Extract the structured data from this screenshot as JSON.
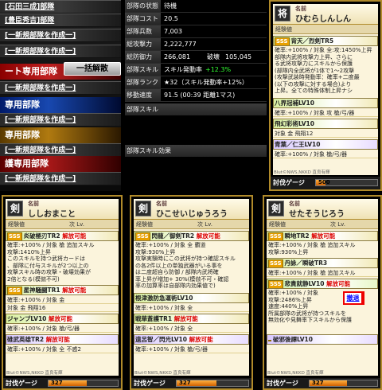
{
  "left_menu": {
    "rows": [
      {
        "type": "link",
        "label": "[石田三成]部隊"
      },
      {
        "type": "link",
        "label": "[豊臣秀吉]部隊"
      },
      {
        "type": "link",
        "label": "[一新規部隊を作成一]"
      },
      {
        "type": "link",
        "label": "[一新規部隊を作成一]"
      },
      {
        "type": "head-red",
        "label": "ート専用部隊"
      },
      {
        "type": "link",
        "label": "[一新規部隊を作成一]"
      },
      {
        "type": "head-blue",
        "label": "専用部隊"
      },
      {
        "type": "link",
        "label": "[一新規部隊を作成一]"
      },
      {
        "type": "head-gold",
        "label": "専用部隊"
      },
      {
        "type": "link",
        "label": "[一新規部隊を作成一]"
      },
      {
        "type": "head-maroon",
        "label": "護専用部隊"
      },
      {
        "type": "link",
        "label": "[一新規部隊を作成一]"
      }
    ],
    "bulk_button": "一括解散"
  },
  "stats": {
    "rows": [
      {
        "label": "部隊の状態",
        "value": "待機"
      },
      {
        "label": "部隊コスト",
        "value": "20.5"
      },
      {
        "label": "部隊兵数",
        "value": "7,003"
      },
      {
        "label": "総攻撃力",
        "value": "2,222,777"
      },
      {
        "label": "総防御力",
        "value": "266,081",
        "extra_label": "破壊",
        "extra_value": "105,045"
      },
      {
        "label": "部隊スキル",
        "value": "スキル発動率",
        "green": "+12.3%"
      },
      {
        "label": "部隊ランク",
        "value": "★32（スキル発動率+12%）"
      },
      {
        "label": "移動速度",
        "value": "91.5 (00:39 距離1マス)"
      }
    ],
    "section_skill": "部隊スキル",
    "section_effect": "部隊スキル効果"
  },
  "cards": [
    {
      "kanji": "将",
      "name_label": "名前",
      "name": "ひむらしんしん",
      "xp_label": "経験値",
      "skills": [
        {
          "rarity": "SSS",
          "title": "背天／烈剣TR5",
          "color": "plain"
        },
        {
          "rarity": "",
          "title": "八界冠補LV10",
          "color": "plain"
        },
        {
          "rarity": "",
          "title": "飛幻彩術LV10",
          "color": "plain"
        },
        {
          "rarity": "",
          "title": "青葉／仁王LV10",
          "color": "purple"
        }
      ],
      "body": [
        "確率:+100% / 対象 全:攻:1450%上昇",
        "部隊内武将攻撃力上昇、さらに",
        "る武将攻撃力にスキルから保護",
        "(部隊内全武将が1体で1〜2攻撃",
        "(攻撃武装時発動率：確率+二度最",
        "(以下の攻撃に対する場合)より",
        "上昇。全ての特殊体制上昇ナシ"
      ],
      "sub1": "確率:+100% / 対象 攻 槍/弓/器",
      "sub2": "対象 金 飛翔12",
      "sub3": "確率:+100% / 対象 槍/弓/器",
      "gauge_label": "討伐ゲージ",
      "gauge_value": "500",
      "gauge_pct": 0.15
    },
    {
      "kanji": "剣",
      "name_label": "名前",
      "name": "ししおまこと",
      "xp_label": "経験値",
      "lv_label": "次 Lv.",
      "skills": [
        {
          "rarity": "SSS",
          "title": "炎破極刃TR2",
          "note": "解放可能",
          "color": "plain"
        },
        {
          "rarity": "SSS",
          "title": "星神騒闘TR1",
          "note": "解放可能",
          "color": "plain"
        },
        {
          "rarity": "",
          "title": "ジャンプLV10",
          "note": "解放可能",
          "color": "plain"
        },
        {
          "rarity": "",
          "title": "碓武英雄TR2",
          "note": "解放可能",
          "color": "purple"
        }
      ],
      "body1": [
        "確率:+100% / 対象 槍 追加スキル",
        "攻撃:1410%上昇",
        "このスキルを持つ武将カードは",
        "、部隊に付与スキルが2つ以上の",
        "攻撃スキル時の攻撃・破壊効果が",
        "2倍となる(模倣不可)"
      ],
      "body2": [
        "確率:+100% / 対象 金",
        "対象 金 飛翔16"
      ],
      "body3": [
        "確率:+100% / 対象 槍/弓/器"
      ],
      "body4": [
        "確率:+100% / 対象 全 不惑2"
      ],
      "gauge_label": "討伐ゲージ",
      "gauge_value": "327",
      "gauge_pct": 0.55
    },
    {
      "kanji": "剣",
      "name_label": "名前",
      "name": "ひこせいじゅうろう",
      "xp_label": "経験値",
      "lv_label": "次 Lv.",
      "skills": [
        {
          "rarity": "SSS",
          "title": "閃龍／御剣TR2",
          "note": "解放可能",
          "color": "plain"
        },
        {
          "rarity": "",
          "title": "根津激防急運術LV10",
          "color": "plain"
        },
        {
          "rarity": "",
          "title": "戦華蒼護TR1",
          "note": "解放可能",
          "color": "plain"
        },
        {
          "rarity": "",
          "title": "遠呂智／閃光LV10",
          "note": "解放可能",
          "color": "purple"
        }
      ],
      "body1": [
        "確率:+100% / 対象 全 覇道",
        "攻撃:930%上昇",
        "攻撃実験時にこの武将が持つ確認スキル",
        "の各2件以上の単独武器がいる事を",
        "は二度超自ら防御 / 部隊内武将確",
        "率上昇が増加+ 30%(模倣不可・確認",
        "率の加算率は自部隊内効果値で)"
      ],
      "body2": [
        "確率:+100% / 対象 全"
      ],
      "body3": [
        "確率:+100% / 対象 全"
      ],
      "body4": [
        "確率:+100% / 対象 槍/弓/器"
      ],
      "gauge_label": "討伐ゲージ",
      "gauge_value": "327",
      "gauge_pct": 0.55
    },
    {
      "kanji": "剣",
      "name_label": "名前",
      "name": "せたそうじろう",
      "xp_label": "経験値",
      "lv_label": "次 Lv.",
      "skills": [
        {
          "rarity": "SSS",
          "title": "瞬地TR2",
          "note": "解放可能",
          "color": "plain"
        },
        {
          "rarity": "SSS",
          "title": "丹詠／瞬破TR3",
          "color": "plain"
        },
        {
          "rarity": "SSS",
          "title": "悲貴就静LV10",
          "note": "解放可能",
          "color": "green"
        },
        {
          "rarity": "",
          "title": "破邪後譚LV10",
          "color": "purple"
        }
      ],
      "body1": [
        "確率:+100% / 対象 槍 追加スキル",
        "攻撃:930%上昇"
      ],
      "body2": [
        "確率:+100% / 対象 槍 追加スキル"
      ],
      "body3": [
        "確率:+100% / 対象",
        "攻撃:2486%上昇",
        "速度:440%上昇",
        "所属部隊の武将が持つスキルを",
        "無効化や見舞率下スキルから保護"
      ],
      "gauge_label": "討伐ゲージ",
      "gauge_value": "327",
      "gauge_pct": 0.55
    }
  ],
  "copyright": "Blut©NWS,NKKD 直良有輝",
  "remove_button": "撤退"
}
